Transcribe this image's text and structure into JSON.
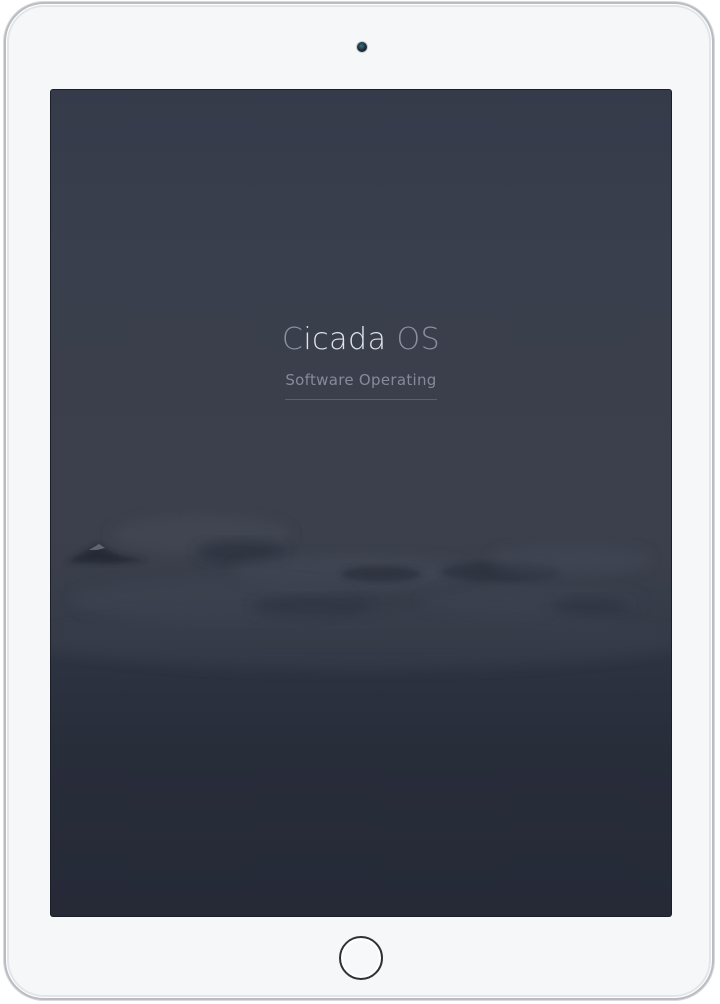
{
  "screen": {
    "title_main": "Cicada",
    "title_accent": "OS",
    "subtitle": "Software Operating"
  },
  "colors": {
    "frame": "#f6f7f9",
    "screen_top": "#353b4a",
    "screen_bottom": "#262a37",
    "title_text": "#dfe3ea",
    "subtitle_text": "#858b9a"
  }
}
